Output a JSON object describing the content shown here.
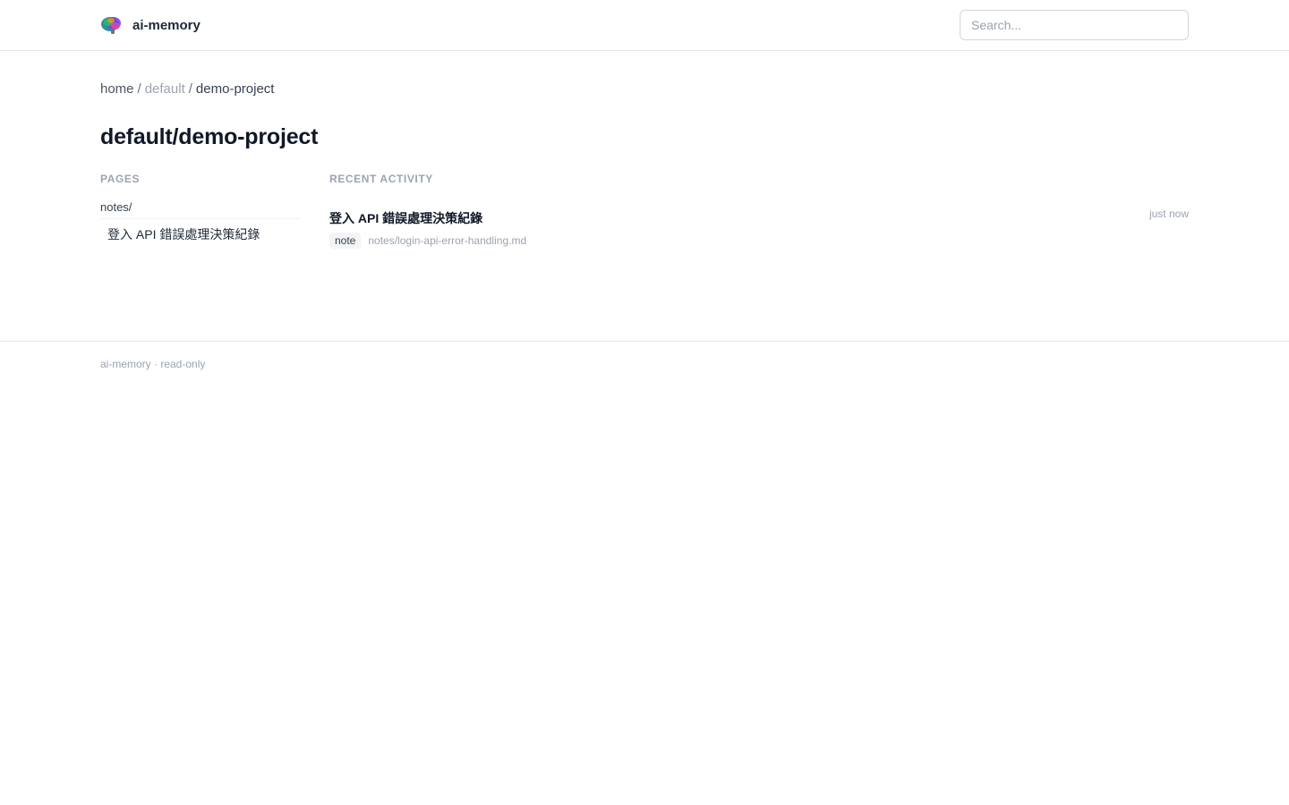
{
  "header": {
    "brand_name": "ai-memory",
    "logo_icon": "brain-icon",
    "search_placeholder": "Search..."
  },
  "breadcrumb": {
    "home": "home",
    "sep1": "/",
    "parent": "default",
    "sep2": "/",
    "current": "demo-project"
  },
  "page_title": "default/demo-project",
  "pages": {
    "section_title": "PAGES",
    "folder": "notes/",
    "items": [
      {
        "label": "登入 API 錯誤處理決策紀錄"
      }
    ]
  },
  "activity": {
    "section_title": "RECENT ACTIVITY",
    "items": [
      {
        "title": "登入 API 錯誤處理決策紀錄",
        "tag": "note",
        "path": "notes/login-api-error-handling.md",
        "time": "just now"
      }
    ]
  },
  "footer": {
    "text": "ai-memory · read-only"
  },
  "colors": {
    "text_primary": "#111827",
    "text_muted": "#9ca3af",
    "border": "#e5e7eb",
    "tag_bg": "#f3f4f6"
  }
}
